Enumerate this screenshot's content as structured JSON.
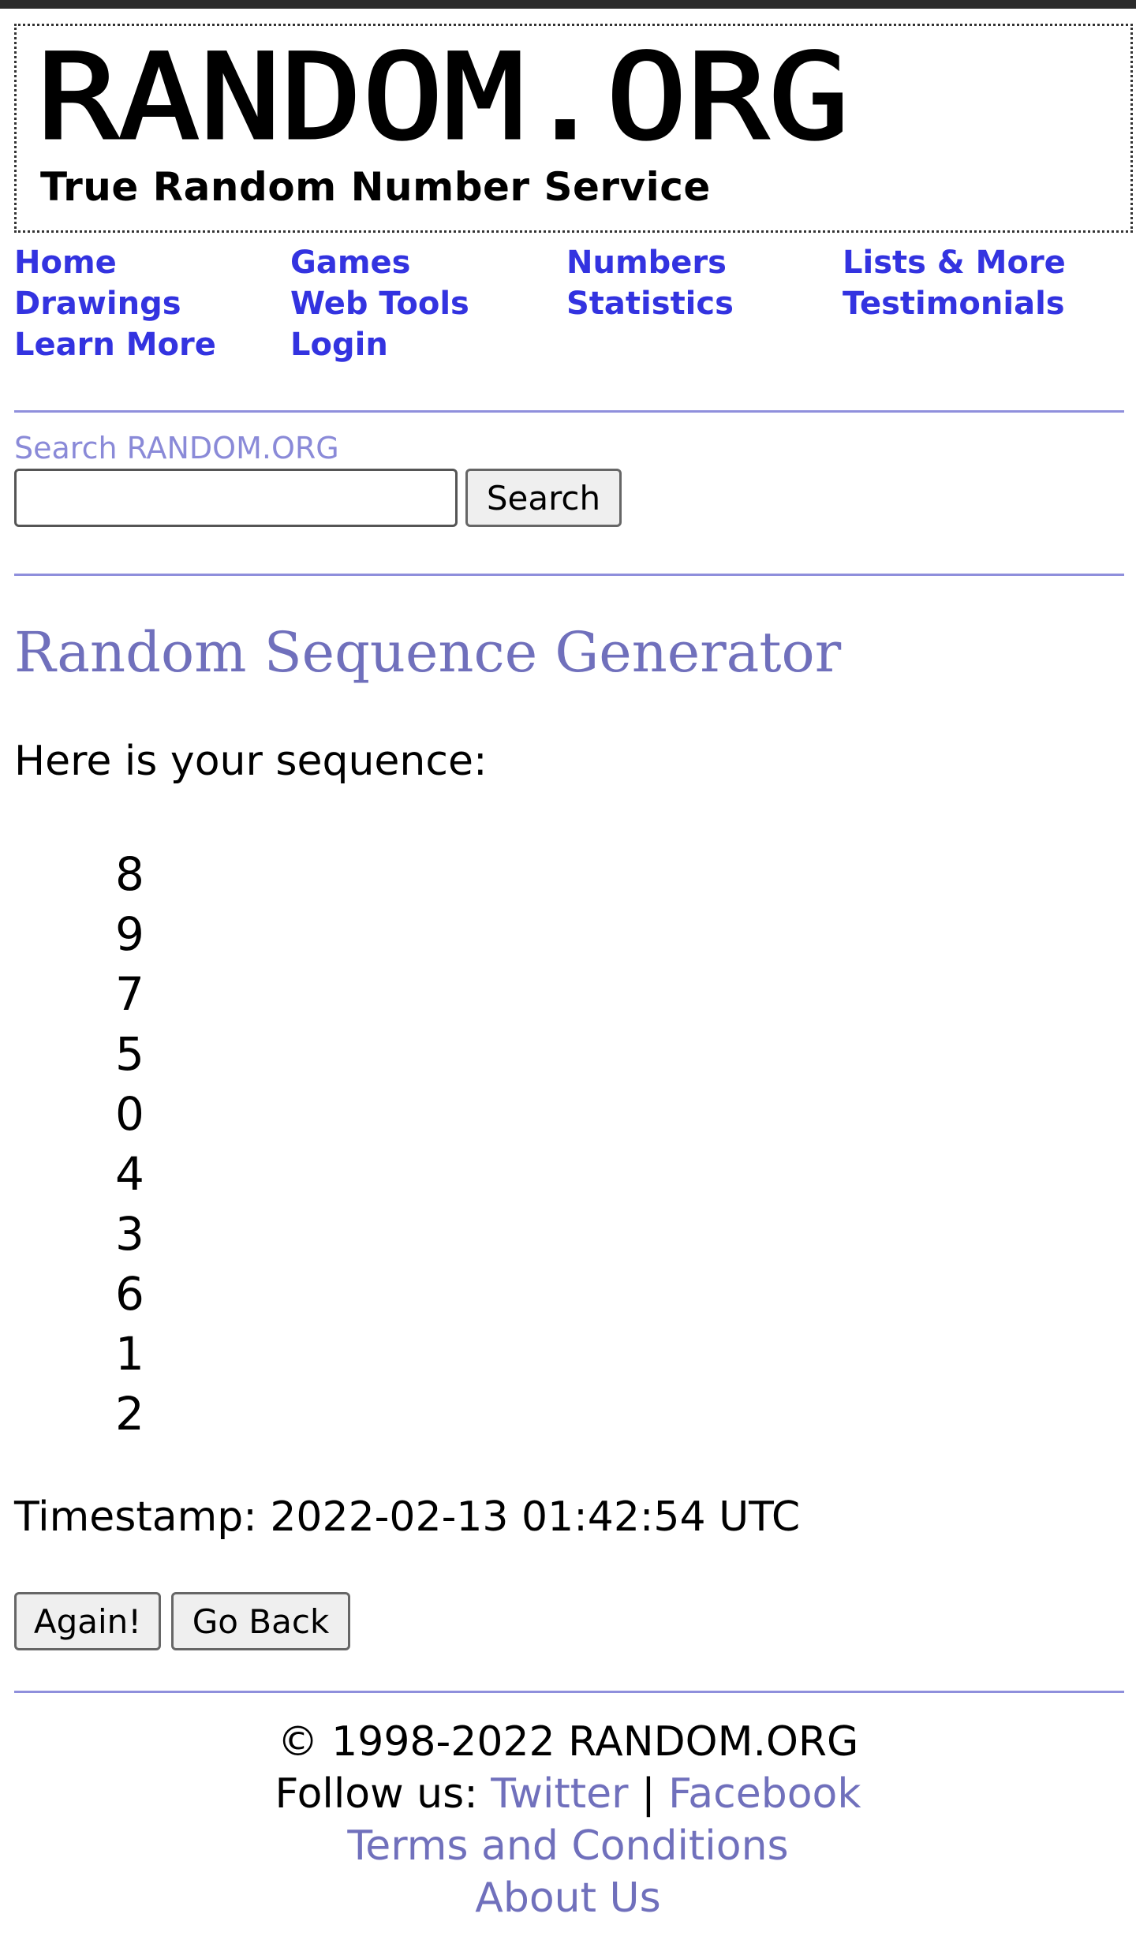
{
  "header": {
    "logo_text": "RANDOM.ORG",
    "tagline": "True Random Number Service"
  },
  "nav": {
    "items": [
      {
        "label": "Home"
      },
      {
        "label": "Games"
      },
      {
        "label": "Numbers"
      },
      {
        "label": "Lists & More"
      },
      {
        "label": "Drawings"
      },
      {
        "label": "Web Tools"
      },
      {
        "label": "Statistics"
      },
      {
        "label": "Testimonials"
      },
      {
        "label": "Learn More"
      },
      {
        "label": "Login"
      }
    ]
  },
  "search": {
    "label": "Search RANDOM.ORG",
    "value": "",
    "button": "Search"
  },
  "main": {
    "title": "Random Sequence Generator",
    "intro": "Here is your sequence:",
    "sequence": [
      "8",
      "9",
      "7",
      "5",
      "0",
      "4",
      "3",
      "6",
      "1",
      "2"
    ],
    "timestamp": "Timestamp: 2022-02-13 01:42:54 UTC",
    "again_button": "Again!",
    "back_button": "Go Back"
  },
  "footer": {
    "copyright": "© 1998-2022 RANDOM.ORG",
    "follow_prefix": "Follow us: ",
    "twitter": "Twitter",
    "separator": " | ",
    "facebook": "Facebook",
    "terms": "Terms and Conditions",
    "about": "About Us"
  },
  "colors": {
    "nav_link": "#3333e0",
    "accent": "#7070bc",
    "rule": "#8f8fdc"
  }
}
